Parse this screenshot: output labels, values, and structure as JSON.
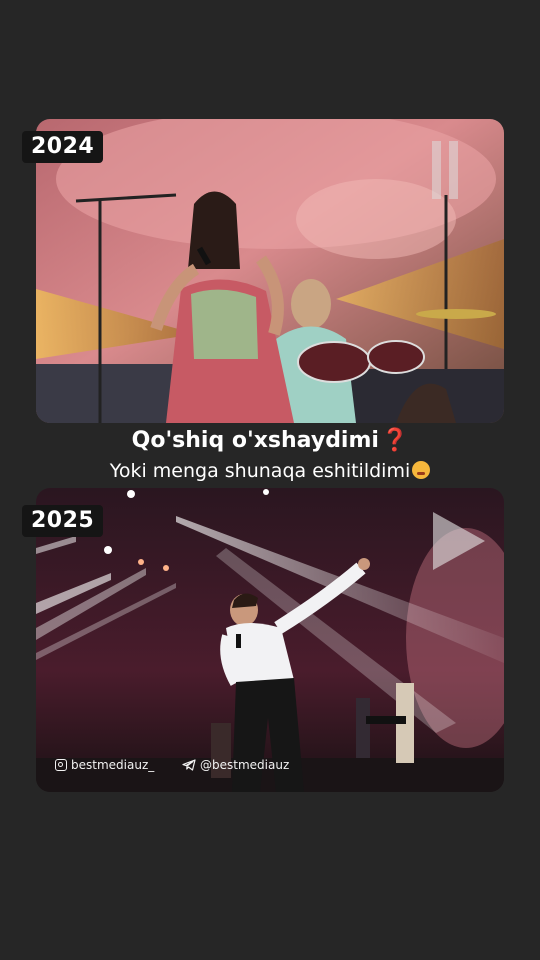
{
  "top_video": {
    "year_label": "2024"
  },
  "bottom_video": {
    "year_label": "2025"
  },
  "caption": {
    "title": "Qo'shiq o'xshaydimi",
    "title_emoji": "❓",
    "subtitle": "Yoki menga shunaqa eshitildimi"
  },
  "watermarks": {
    "instagram": "bestmediauz_",
    "telegram": "@bestmediauz"
  },
  "icons": {
    "pause": "pause-icon",
    "play": "play-icon",
    "instagram": "instagram-icon",
    "telegram": "telegram-icon",
    "face": "flushed-face-emoji"
  },
  "colors": {
    "background": "#262626",
    "year_badge": "#151515",
    "question_mark": "#e53935"
  }
}
